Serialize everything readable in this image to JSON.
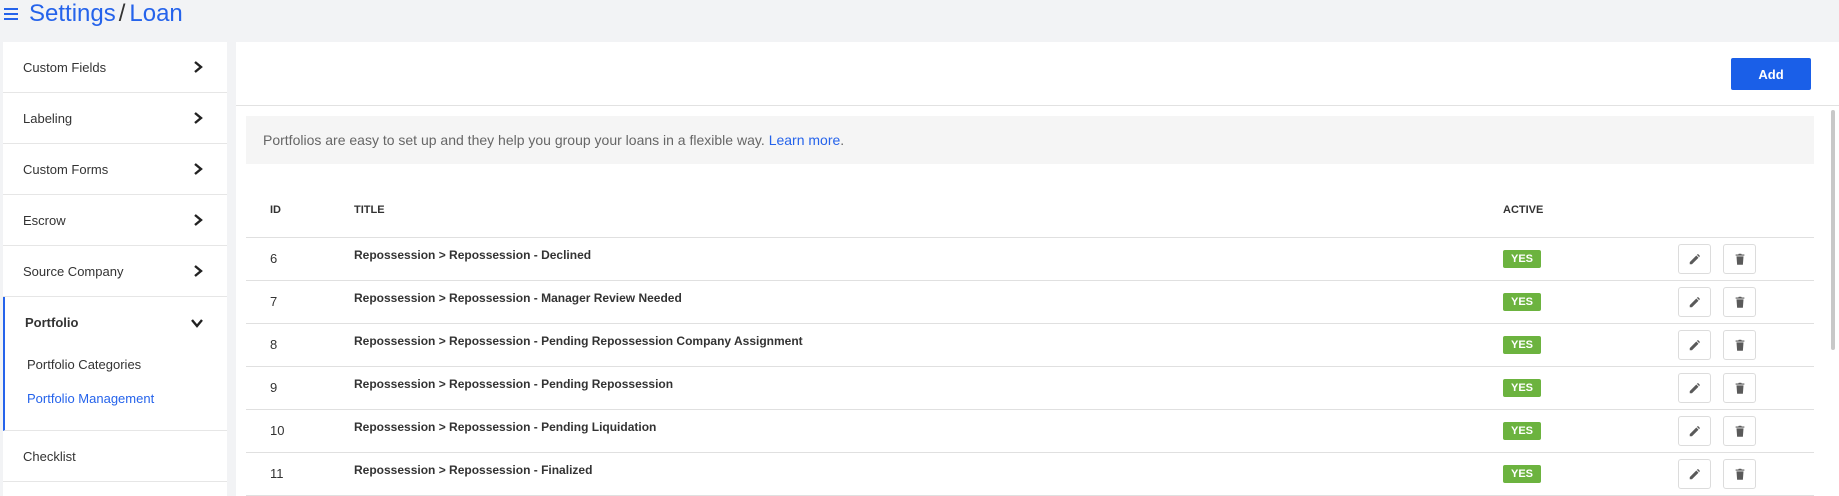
{
  "breadcrumb": {
    "root": "Settings",
    "separator": "/",
    "leaf": "Loan"
  },
  "sidebar": {
    "items": [
      {
        "label": "Custom Fields"
      },
      {
        "label": "Labeling"
      },
      {
        "label": "Custom Forms"
      },
      {
        "label": "Escrow"
      },
      {
        "label": "Source Company"
      }
    ],
    "group": {
      "label": "Portfolio",
      "children": [
        {
          "label": "Portfolio Categories"
        },
        {
          "label": "Portfolio Management",
          "active": true
        }
      ]
    },
    "after": [
      {
        "label": "Checklist"
      }
    ]
  },
  "toolbar": {
    "add_label": "Add"
  },
  "info": {
    "text": "Portfolios are easy to set up and they help you group your loans in a flexible way.",
    "link": "Learn more",
    "link_suffix": "."
  },
  "table": {
    "headers": {
      "id": "ID",
      "title": "TITLE",
      "active": "ACTIVE"
    },
    "rows": [
      {
        "id": "6",
        "title": "Repossession > Repossession - Declined",
        "active": "YES"
      },
      {
        "id": "7",
        "title": "Repossession > Repossession - Manager Review Needed",
        "active": "YES"
      },
      {
        "id": "8",
        "title": "Repossession > Repossession - Pending Repossession Company Assignment",
        "active": "YES"
      },
      {
        "id": "9",
        "title": "Repossession > Repossession - Pending Repossession",
        "active": "YES"
      },
      {
        "id": "10",
        "title": "Repossession > Repossession - Pending Liquidation",
        "active": "YES"
      },
      {
        "id": "11",
        "title": "Repossession > Repossession - Finalized",
        "active": "YES"
      }
    ]
  },
  "colors": {
    "accent": "#2563eb",
    "active_badge": "#6cb33f",
    "add_button": "#1a5fe8"
  },
  "icons": {
    "menu": "hamburger-icon",
    "chevron_right": "chevron-right-icon",
    "chevron_down": "chevron-down-icon",
    "edit": "pencil-icon",
    "delete": "trash-icon"
  }
}
